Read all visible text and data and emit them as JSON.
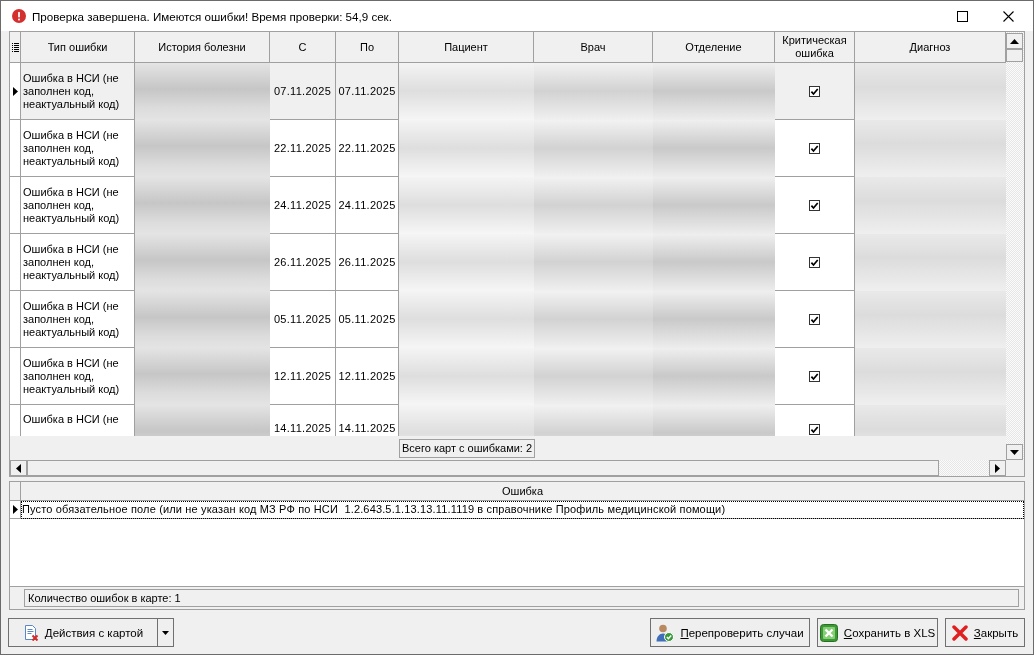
{
  "window": {
    "title": "Проверка завершена. Имеются ошибки! Время проверки: 54,9 сек."
  },
  "cards_grid": {
    "columns": [
      {
        "label": "Тип ошибки",
        "kind": "text"
      },
      {
        "label": "История болезни",
        "kind": "blurred"
      },
      {
        "label": "С",
        "kind": "date"
      },
      {
        "label": "По",
        "kind": "date"
      },
      {
        "label": "Пациент",
        "kind": "blurred"
      },
      {
        "label": "Врач",
        "kind": "blurred"
      },
      {
        "label": "Отделение",
        "kind": "blurred"
      },
      {
        "label": "Критическая ошибка",
        "kind": "check"
      },
      {
        "label": "Диагноз",
        "kind": "blurred"
      }
    ],
    "rows": [
      {
        "cells": [
          "Ошибка в НСИ (не заполнен код, неактуальный код)",
          "",
          "07.11.2025",
          "07.11.2025",
          "",
          "",
          "",
          true,
          ""
        ],
        "selected": true
      },
      {
        "cells": [
          "Ошибка в НСИ (не заполнен код, неактуальный код)",
          "",
          "22.11.2025",
          "22.11.2025",
          "",
          "",
          "",
          true,
          ""
        ],
        "selected": false
      },
      {
        "cells": [
          "Ошибка в НСИ (не заполнен код, неактуальный код)",
          "",
          "24.11.2025",
          "24.11.2025",
          "",
          "",
          "",
          true,
          ""
        ],
        "selected": false
      },
      {
        "cells": [
          "Ошибка в НСИ (не заполнен код, неактуальный код)",
          "",
          "26.11.2025",
          "26.11.2025",
          "",
          "",
          "",
          true,
          ""
        ],
        "selected": false
      },
      {
        "cells": [
          "Ошибка в НСИ (не заполнен код, неактуальный код)",
          "",
          "05.11.2025",
          "05.11.2025",
          "",
          "",
          "",
          true,
          ""
        ],
        "selected": false
      },
      {
        "cells": [
          "Ошибка в НСИ (не заполнен код, неактуальный код)",
          "",
          "12.11.2025",
          "12.11.2025",
          "",
          "",
          "",
          true,
          ""
        ],
        "selected": false
      },
      {
        "cells": [
          "Ошибка в НСИ (не",
          "",
          "14.11.2025",
          "14.11.2025",
          "",
          "",
          "",
          true,
          ""
        ],
        "selected": false
      }
    ],
    "total": "Всего карт с ошибками: 2"
  },
  "errors_grid": {
    "column": "Ошибка",
    "rows": [
      {
        "text": "Пусто обязательное поле (или не указан код МЗ РФ по НСИ  1.2.643.5.1.13.13.11.1119 в справочнике Профиль медицинской помощи)",
        "selected": true
      }
    ],
    "count": "Количество ошибок в карте: 1"
  },
  "buttons": [
    {
      "label": "Действия с картой",
      "kind": "card_actions"
    },
    {
      "label": "Перепроверить случаи",
      "kind": "recheck"
    },
    {
      "label": "Сохранить в XLS",
      "kind": "save_xls"
    },
    {
      "label": "Закрыть",
      "kind": "close"
    }
  ]
}
